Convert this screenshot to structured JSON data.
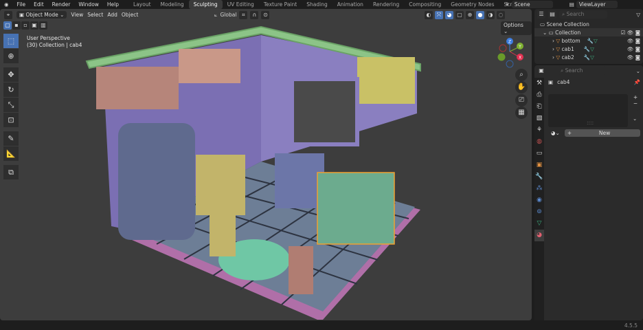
{
  "topbar": {
    "menus": [
      "File",
      "Edit",
      "Render",
      "Window",
      "Help"
    ],
    "workspaces": [
      "Layout",
      "Modeling",
      "Sculpting",
      "UV Editing",
      "Texture Paint",
      "Shading",
      "Animation",
      "Rendering",
      "Compositing",
      "Geometry Nodes",
      "Scripting"
    ],
    "active_workspace": "Sculpting",
    "add_tab": "+",
    "scene": "Scene",
    "view_layer": "ViewLayer"
  },
  "viewport": {
    "mode": "Object Mode",
    "menus": [
      "View",
      "Select",
      "Add",
      "Object"
    ],
    "orientation": "Global",
    "options": "Options",
    "perspective": "User Perspective",
    "context": "(30) Collection | cab4",
    "gizmo": {
      "z": "Z",
      "y": "Y",
      "x": "X"
    }
  },
  "outliner": {
    "search_placeholder": "Search",
    "scene_collection": "Scene Collection",
    "collection": "Collection",
    "items": [
      "bottom",
      "cab1",
      "cab2"
    ]
  },
  "properties": {
    "search_placeholder": "Search",
    "object": "cab4",
    "new_label": "New",
    "active_tab": "material"
  },
  "status": {
    "version": "4.5.5"
  },
  "colors": {
    "accent": "#4772b3",
    "selection": "#f0a030",
    "wall": "#7b6fb3",
    "floor": "#6d7e96",
    "trim": "#8cc487"
  }
}
